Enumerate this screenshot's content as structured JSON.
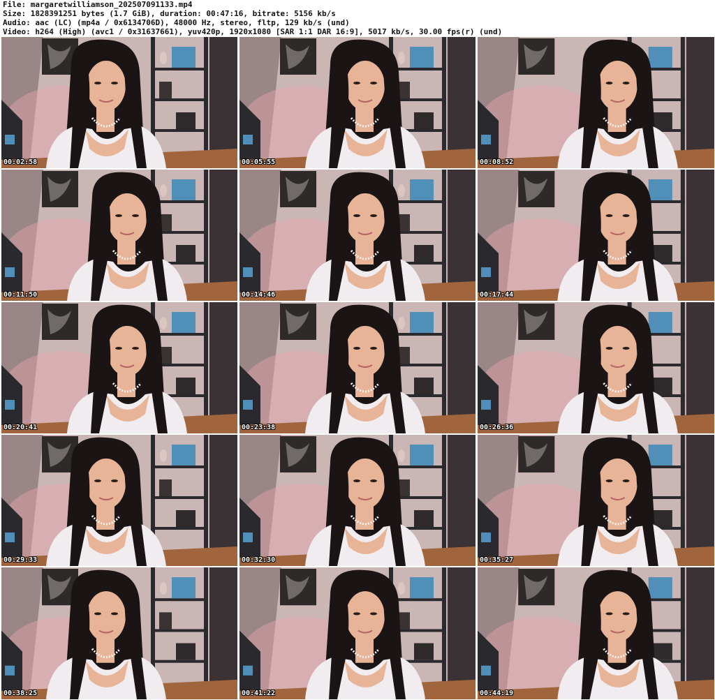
{
  "header": {
    "file": "File: margaretwilliamson_202507091133.mp4",
    "size": "Size: 1828391251 bytes (1.7 GiB), duration: 00:47:16, bitrate: 5156 kb/s",
    "audio": "Audio: aac (LC) (mp4a / 0x6134706D), 48000 Hz, stereo, fltp, 129 kb/s (und)",
    "video": "Video: h264 (High) (avc1 / 0x31637661), yuv420p, 1920x1080 [SAR 1:1 DAR 16:9], 5017 kb/s, 30.00 fps(r) (und)"
  },
  "thumbnails": [
    {
      "timestamp": "00:02:58",
      "variant": 0
    },
    {
      "timestamp": "00:05:55",
      "variant": 1
    },
    {
      "timestamp": "00:08:52",
      "variant": 2
    },
    {
      "timestamp": "00:11:50",
      "variant": 1
    },
    {
      "timestamp": "00:14:46",
      "variant": 1
    },
    {
      "timestamp": "00:17:44",
      "variant": 2
    },
    {
      "timestamp": "00:20:41",
      "variant": 1
    },
    {
      "timestamp": "00:23:38",
      "variant": 1
    },
    {
      "timestamp": "00:26:36",
      "variant": 2
    },
    {
      "timestamp": "00:29:33",
      "variant": 0
    },
    {
      "timestamp": "00:32:30",
      "variant": 1
    },
    {
      "timestamp": "00:35:27",
      "variant": 2
    },
    {
      "timestamp": "00:38:25",
      "variant": 0
    },
    {
      "timestamp": "00:41:22",
      "variant": 1
    },
    {
      "timestamp": "00:44:19",
      "variant": 2
    }
  ],
  "colors": {
    "wall": "#cbb6b6",
    "wall_shade": "#9a8687",
    "shelf": "#2a2a2e",
    "shelf_box": "#4f8fb8",
    "floor": "#a0653c",
    "hair": "#1a1414",
    "skin": "#e8b497",
    "top": "#f1ecef",
    "poster": "#2e2a2a"
  }
}
